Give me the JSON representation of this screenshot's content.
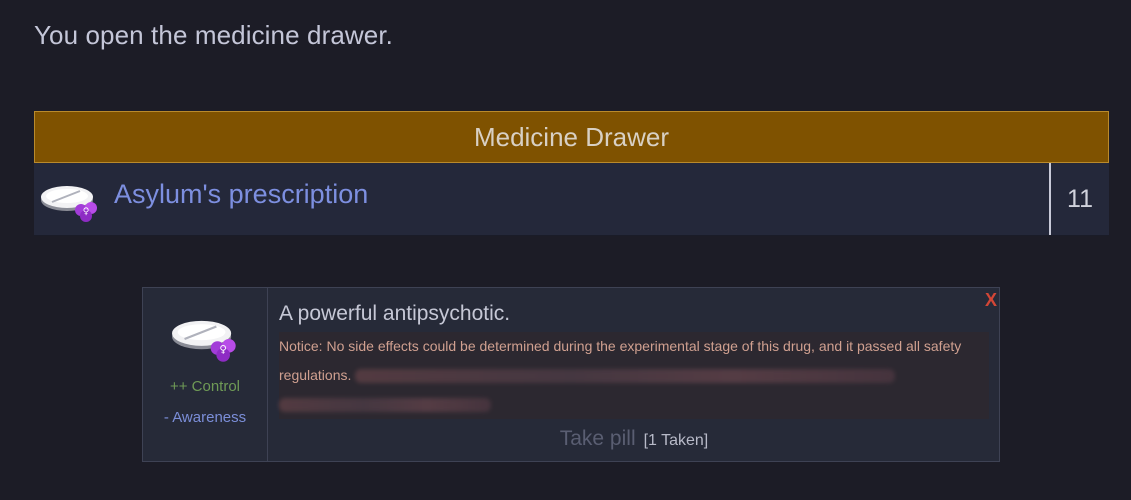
{
  "intro_text": "You open the medicine drawer.",
  "drawer": {
    "title": "Medicine Drawer",
    "items": [
      {
        "name": "Asylum's prescription",
        "count": "11",
        "icon": "pill-icon"
      }
    ]
  },
  "popup": {
    "close_label": "X",
    "icon": "pill-icon",
    "stats": [
      "++ Control",
      "- Awareness"
    ],
    "description": "A powerful antipsychotic.",
    "notice": "Notice: No side effects could be determined during the experimental stage of this drug, and it passed all safety regulations.",
    "take_label": "Take pill",
    "taken_label": "[1 Taken]"
  },
  "colors": {
    "header_bg": "#7f5200",
    "link": "#7d8fe0",
    "close": "#d24636",
    "stat_up": "#6f9a56",
    "stat_down": "#7b8ed8"
  }
}
